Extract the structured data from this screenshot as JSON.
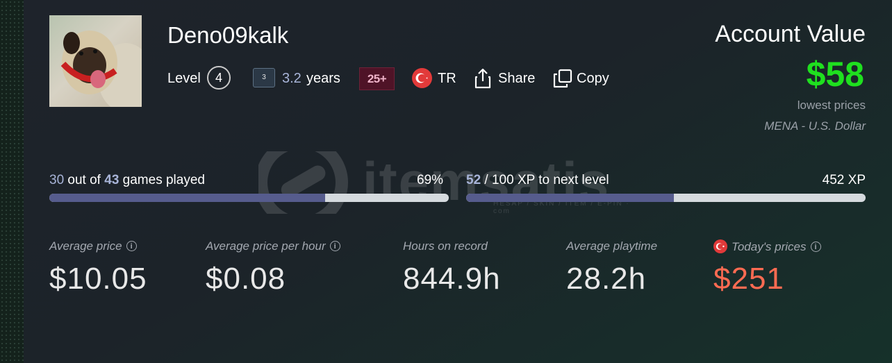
{
  "profile": {
    "username": "Deno09kalk",
    "level_label": "Level",
    "level": "4",
    "years_icon_number": "3",
    "years_value": "3.2",
    "years_unit": "years",
    "age_badge": "25+",
    "country_code": "TR",
    "share_label": "Share",
    "copy_label": "Copy"
  },
  "account_value": {
    "title": "Account Value",
    "value": "$58",
    "note": "lowest prices",
    "region": "MENA - U.S. Dollar"
  },
  "games_progress": {
    "played": "30",
    "text_out_of": " out of ",
    "total": "43",
    "text_suffix": " games played",
    "percent_label": "69%",
    "fill_fraction": 0.69
  },
  "xp_progress": {
    "current": "52",
    "text_suffix": " / 100 XP to next level",
    "xp_total": "452 XP",
    "fill_fraction": 0.52
  },
  "stats": [
    {
      "label": "Average price",
      "value": "$10.05",
      "has_info": true
    },
    {
      "label": "Average price per hour",
      "value": "$0.08",
      "has_info": true
    },
    {
      "label": "Hours on record",
      "value": "844.9h",
      "has_info": false
    },
    {
      "label": "Average playtime",
      "value": "28.2h",
      "has_info": false
    },
    {
      "label": "Today's prices",
      "value": "$251",
      "has_info": true
    }
  ],
  "watermark": {
    "text": "itemsatis",
    "sub": "HESAP / SKIN / ITEM / E-PIN · com"
  },
  "colors": {
    "accent_green": "#1fe01f",
    "today_price": "#ff6b52",
    "bar_fill": "#565c8d",
    "bar_track": "#d5dade",
    "highlight": "#a8b4d8"
  }
}
